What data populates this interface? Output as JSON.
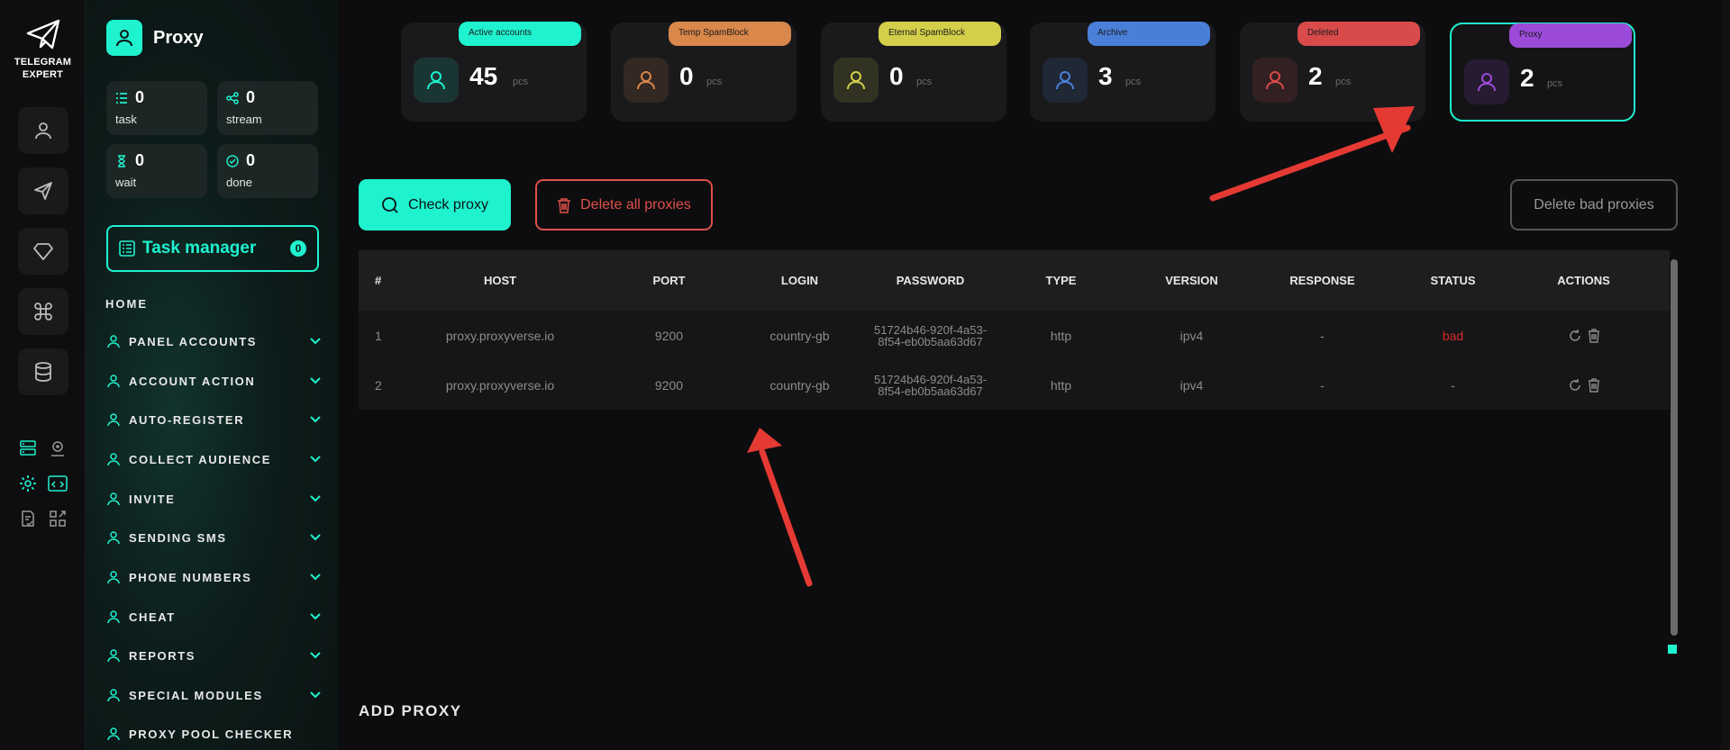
{
  "brand": {
    "line1": "TELEGRAM",
    "line2": "EXPERT"
  },
  "rail_icons": [
    "user-icon",
    "send-icon",
    "diamond-icon",
    "command-icon",
    "database-icon"
  ],
  "rail_small_icons": [
    "server-list-icon",
    "location-pin-icon",
    "gear-icon",
    "code-window-icon",
    "document-check-icon",
    "grid-arrow-icon"
  ],
  "sidebar": {
    "title": "Proxy",
    "stats": [
      {
        "value": "0",
        "label": "task"
      },
      {
        "value": "0",
        "label": "stream"
      },
      {
        "value": "0",
        "label": "wait"
      },
      {
        "value": "0",
        "label": "done"
      }
    ],
    "task_manager": {
      "label": "Task manager",
      "count": "0"
    },
    "home": "HOME",
    "nav": [
      {
        "label": "PANEL ACCOUNTS",
        "icon": "users-icon"
      },
      {
        "label": "ACCOUNT ACTION",
        "icon": "user-icon"
      },
      {
        "label": "AUTO-REGISTER",
        "icon": "user-plus-icon"
      },
      {
        "label": "COLLECT AUDIENCE",
        "icon": "user-list-icon"
      },
      {
        "label": "INVITE",
        "icon": "user-invite-icon"
      },
      {
        "label": "SENDING SMS",
        "icon": "send-icon"
      },
      {
        "label": "PHONE NUMBERS",
        "icon": "phone-icon"
      },
      {
        "label": "CHEAT",
        "icon": "send-plus-icon"
      },
      {
        "label": "REPORTS",
        "icon": "report-icon"
      },
      {
        "label": "SPECIAL MODULES",
        "icon": "modules-icon"
      },
      {
        "label": "PROXY POOL CHECKER",
        "icon": "network-icon"
      }
    ]
  },
  "cards": [
    {
      "label": "Active accounts",
      "value": "45",
      "unit": "pcs",
      "color": "#1ff2cf",
      "icon": "user-heart-icon"
    },
    {
      "label": "Temp SpamBlock",
      "value": "0",
      "unit": "pcs",
      "color": "#d9874a",
      "icon": "warning-octagon-icon"
    },
    {
      "label": "Eternal SpamBlock",
      "value": "0",
      "unit": "pcs",
      "color": "#d4cf4a",
      "icon": "mail-block-icon"
    },
    {
      "label": "Archive",
      "value": "3",
      "unit": "pcs",
      "color": "#4a7fd9",
      "icon": "archive-folder-icon"
    },
    {
      "label": "Deleted",
      "value": "2",
      "unit": "pcs",
      "color": "#d94a4a",
      "icon": "user-x-icon"
    },
    {
      "label": "Proxy",
      "value": "2",
      "unit": "pcs",
      "color": "#9b4ad9",
      "icon": "proxy-monitor-icon"
    }
  ],
  "buttons": {
    "check": "Check proxy",
    "delete_all": "Delete all proxies",
    "delete_bad": "Delete bad proxies"
  },
  "table": {
    "headers": [
      "#",
      "HOST",
      "PORT",
      "LOGIN",
      "PASSWORD",
      "TYPE",
      "VERSION",
      "RESPONSE",
      "STATUS",
      "ACTIONS"
    ],
    "rows": [
      {
        "n": "1",
        "host": "proxy.proxyverse.io",
        "port": "9200",
        "login": "country-gb",
        "password": "51724b46-920f-4a53-8f54-eb0b5aa63d67",
        "type": "http",
        "version": "ipv4",
        "response": "-",
        "status": "bad"
      },
      {
        "n": "2",
        "host": "proxy.proxyverse.io",
        "port": "9200",
        "login": "country-gb",
        "password": "51724b46-920f-4a53-8f54-eb0b5aa63d67",
        "type": "http",
        "version": "ipv4",
        "response": "-",
        "status": "-"
      }
    ]
  },
  "add_proxy": "ADD PROXY"
}
